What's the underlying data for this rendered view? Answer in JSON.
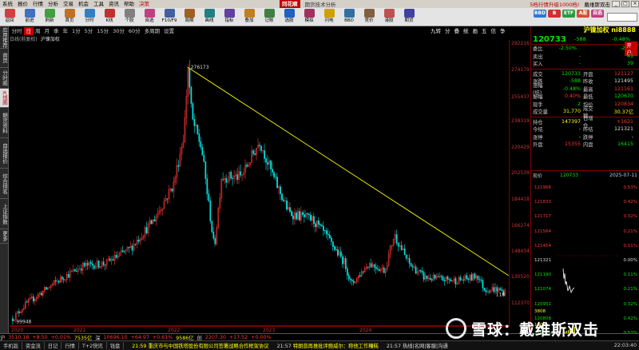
{
  "menubar": {
    "items": [
      "系统",
      "报价",
      "行情",
      "分析",
      "交易",
      "机会",
      "工具",
      "资讯",
      "帮助",
      "决策"
    ],
    "logo": "同花顺",
    "title": "期货技术分析",
    "promo": "5档行情升级1000档!",
    "brand": "戴维斯双击"
  },
  "toolbar": {
    "buttons": [
      "返回",
      "前进",
      "刷新",
      "首页",
      "分时",
      "K线",
      "个股",
      "自选",
      "F10/F9",
      "周期",
      "画线",
      "指标",
      "叠加",
      "记账",
      "选股",
      "模拟",
      "闪电",
      "BBD",
      "竞价",
      "港股",
      "期货"
    ],
    "right": [
      "BBD",
      "B",
      "ETF",
      "A股",
      "自选"
    ]
  },
  "sidebar": {
    "items": [
      "应用推荐",
      "首页",
      "分时图",
      "K线图",
      "期货资料",
      "自选报价",
      "综合排名",
      "上证指数",
      "更多"
    ],
    "active": "K线图"
  },
  "periodbar": {
    "items": [
      "分时",
      "日",
      "周",
      "月",
      "季",
      "年",
      "1分",
      "5分",
      "15分",
      "30分",
      "60分",
      "多周期",
      "设置"
    ],
    "active": "日",
    "right": [
      "九转",
      "分",
      "叠",
      "统",
      "画",
      "五",
      "信",
      "争"
    ]
  },
  "chart_title": {
    "line1": "日线(前复权)",
    "name": "沪镍加权"
  },
  "chart_data": {
    "type": "candlestick",
    "title": "沪镍加权 日线(前复权)",
    "y_ticks": [
      292216,
      274179,
      255437,
      238319,
      220429,
      202539,
      184418,
      166274,
      148434,
      130520,
      112370
    ],
    "x_ticks": [
      "2020",
      "2021",
      "2022",
      "2023",
      "2024"
    ],
    "annotations": {
      "high": "276173",
      "low": "99948",
      "last_low": "118"
    },
    "trendline": {
      "from": [
        "2022-03",
        276173
      ],
      "to": [
        "2025-07",
        132000
      ]
    },
    "colors": {
      "up": "#ff3333",
      "down": "#00e6e6",
      "trend": "#ffff00",
      "axis": "#800000"
    }
  },
  "quote": {
    "name": "沪镍加权 ni8888",
    "price": "120733",
    "change": "-588",
    "pct": "-0.48%",
    "rows": [
      {
        "a": "委比",
        "b": "-2.50%",
        "c": "",
        "d": "-2",
        "tag": "开户"
      },
      {
        "a": "卖出",
        "b": "-",
        "c": "",
        "d": "41"
      },
      {
        "a": "买入",
        "b": "-",
        "c": "",
        "d": "39"
      },
      {
        "a": "成交",
        "b": "120733",
        "c": "开盘",
        "d": "121127"
      },
      {
        "a": "涨跌",
        "b": "-588",
        "c": "昨收",
        "d": "121495"
      },
      {
        "a": "涨幅(结)",
        "b": "-0.48%",
        "c": "最高",
        "d": "121161"
      },
      {
        "a": "振幅",
        "b": "0.40%",
        "c": "最低",
        "d": "120670"
      },
      {
        "a": "现手",
        "b": "2",
        "c": "均价",
        "d": "120834"
      },
      {
        "a": "成交量",
        "b": "31,770",
        "c": "成交额",
        "d": "30.37亿"
      },
      {
        "a": "持仓",
        "b": "147397",
        "c": "日增仓",
        "d": "+1621"
      },
      {
        "a": "今结",
        "b": "-",
        "c": "昨结",
        "d": "121321"
      },
      {
        "a": "涨停",
        "b": "-",
        "c": "跌停",
        "d": "-"
      },
      {
        "a": "外盘",
        "b": "15355",
        "c": "内盘",
        "d": "16415"
      }
    ]
  },
  "tick": {
    "label": "现价",
    "value": "120733",
    "date": "2025-07-11",
    "left": [
      "121966",
      "121833",
      "121717",
      "121564",
      "121454",
      "121321",
      "121190",
      "121074",
      "120951",
      "120808",
      "120675"
    ],
    "right": [
      "0.53%",
      "0.42%",
      "0.32%",
      "0.21%",
      "0.11%",
      "0.00%",
      "0.11%",
      "0.21%",
      "0.32%",
      "0.42%",
      "0.53%"
    ],
    "vol": [
      "3808",
      "1900"
    ]
  },
  "status": {
    "index1_name": "沪",
    "index1_val": "3510.18",
    "index1_chg": "+8.50",
    "index1_pct": "+0.01%",
    "index1_amt": "7535亿",
    "index2_name": "深",
    "index2_val": "10696.10",
    "index2_chg": "+64.97",
    "index2_pct": "+0.61%",
    "index2_amt": "9586亿",
    "index3_name": "创",
    "index3_val": "2207.30",
    "index3_chg": "+17.52",
    "index3_pct": "+0.00%"
  },
  "bottom": {
    "tabs": [
      "手机版",
      "资金流",
      "日记",
      "行情",
      "T+2快讯",
      "钱盘"
    ],
    "news1_time": "21:59",
    "news1": "重庆市与中国铁塔股份有限公司签署战略合作框架协议",
    "news2_time": "21:57",
    "news2": "特朗普再推批评鲍威尔：称他工作糟糕",
    "news3_time": "21:57",
    "news3": "热线|名网|客服|沟通",
    "clock": "22:03:40"
  },
  "watermark": {
    "text": "雪球：戴维斯双击"
  }
}
